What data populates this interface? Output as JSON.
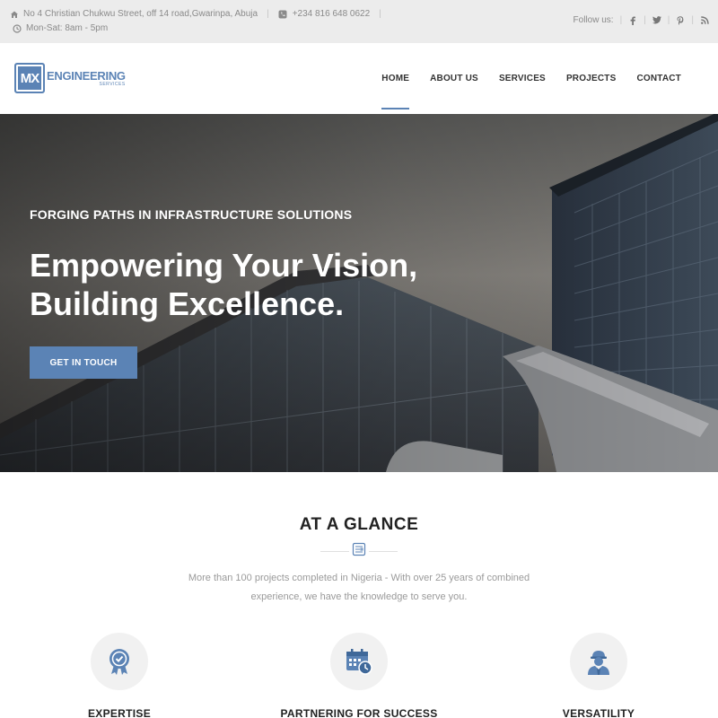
{
  "topbar": {
    "address": "No 4 Christian Chukwu Street, off 14 road,Gwarinpa, Abuja",
    "phone": "+234 816 648 0622",
    "hours": "Mon-Sat: 8am - 5pm",
    "follow_label": "Follow us:",
    "social": [
      "facebook-icon",
      "twitter-icon",
      "pinterest-icon",
      "rss-icon"
    ]
  },
  "logo": {
    "mark": "MX",
    "name": "ENGINEERING",
    "tagline": "SERVICES"
  },
  "nav": {
    "items": [
      "HOME",
      "ABOUT US",
      "SERVICES",
      "PROJECTS",
      "CONTACT"
    ],
    "active": "HOME"
  },
  "hero": {
    "subtitle": "FORGING PATHS IN INFRASTRUCTURE SOLUTIONS",
    "title_line1": "Empowering Your Vision,",
    "title_line2": "Building Excellence.",
    "button": "GET IN TOUCH"
  },
  "glance": {
    "title": "AT A GLANCE",
    "text": "More than 100 projects completed in Nigeria - With over 25 years of combined experience, we have the knowledge to serve you.",
    "features": [
      {
        "label": "EXPERTISE",
        "icon": "award-badge-icon"
      },
      {
        "label": "PARTNERING FOR SUCCESS",
        "icon": "calendar-clock-icon"
      },
      {
        "label": "VERSATILITY",
        "icon": "engineer-worker-icon"
      }
    ]
  },
  "colors": {
    "accent": "#5b83b5",
    "topbar_bg": "#ececec"
  }
}
